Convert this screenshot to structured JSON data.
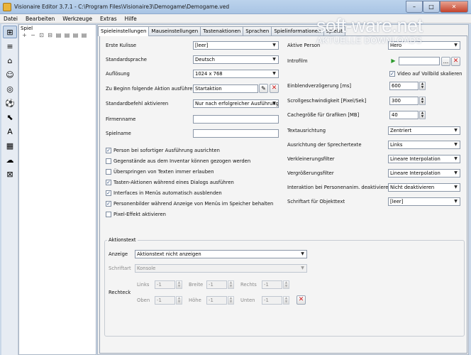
{
  "window": {
    "title": "Visionaire Editor 3.7.1 - C:\\Program Files\\Visionaire3\\Demogame\\Demogame.ved",
    "min_glyph": "–",
    "max_glyph": "□",
    "close_glyph": "✕"
  },
  "watermark": {
    "brand": "soft-ware.net",
    "tagline": "AKTUELLE DOWNLOADS"
  },
  "menu": [
    "Datei",
    "Bearbeiten",
    "Werkzeuge",
    "Extras",
    "Hilfe"
  ],
  "tree": {
    "header": "Spiel",
    "toolbar": [
      "+",
      "−",
      "⊡",
      "⊟",
      "▤",
      "▤",
      "▤",
      "▤"
    ]
  },
  "tabs": [
    "Spieleinstellungen",
    "Mauseinstellungen",
    "Tastenaktionen",
    "Sprachen",
    "Spielinformationen",
    "Spielst"
  ],
  "left": {
    "erste_kulisse": {
      "label": "Erste Kulisse",
      "value": "[leer]"
    },
    "standardsprache": {
      "label": "Standardsprache",
      "value": "Deutsch"
    },
    "aufloesung": {
      "label": "Auflösung",
      "value": "1024 x 768"
    },
    "beginn_aktion": {
      "label": "Zu Beginn folgende Aktion ausführen",
      "value": "Startaktion"
    },
    "standardbefehl": {
      "label": "Standardbefehl aktivieren",
      "value": "Nur nach erfolgreicher Ausführung"
    },
    "firmenname": {
      "label": "Firmenname",
      "value": ""
    },
    "spielname": {
      "label": "Spielname",
      "value": ""
    }
  },
  "checks": [
    {
      "label": "Person bei sofortiger Ausführung ausrichten",
      "checked": true,
      "mark": "✓"
    },
    {
      "label": "Gegenstände aus dem Inventar können gezogen werden",
      "checked": false,
      "mark": ""
    },
    {
      "label": "Überspringen von Texten immer erlauben",
      "checked": false,
      "mark": ""
    },
    {
      "label": "Tasten-Aktionen während eines Dialogs ausführen",
      "checked": true,
      "mark": "✓"
    },
    {
      "label": "Interfaces in Menüs automatisch ausblenden",
      "checked": true,
      "mark": "✓"
    },
    {
      "label": "Personenbilder während Anzeige von Menüs im Speicher behalten",
      "checked": true,
      "mark": "✓"
    },
    {
      "label": "Pixel-Effekt aktivieren",
      "checked": false,
      "mark": ""
    }
  ],
  "right": {
    "aktive_person": {
      "label": "Aktive Person",
      "value": "Hero"
    },
    "introfilm": {
      "label": "Introfilm",
      "value": "",
      "play_glyph": "▶",
      "browse": "...",
      "clear_glyph": "✕"
    },
    "video_skalieren": {
      "label": "Video auf Vollbild skalieren",
      "checked": true,
      "mark": "✓"
    },
    "einblend": {
      "label": "Einblendverzögerung [ms]",
      "value": "600"
    },
    "scroll": {
      "label": "Scrollgeschwindigkeit [Pixel/Sek]",
      "value": "300"
    },
    "cache": {
      "label": "Cachegröße für Grafiken [MB]",
      "value": "40"
    },
    "textausrichtung": {
      "label": "Textausrichtung",
      "value": "Zentriert"
    },
    "sprechertexte": {
      "label": "Ausrichtung der Sprechertexte",
      "value": "Links"
    },
    "verkleinerung": {
      "label": "Verkleinerungsfilter",
      "value": "Lineare Interpolation"
    },
    "vergroesserung": {
      "label": "Vergrößerungsfilter",
      "value": "Lineare Interpolation"
    },
    "interaktion": {
      "label": "Interaktion bei Personenanim. deaktivieren",
      "value": "Nicht deaktivieren"
    },
    "schriftart_obj": {
      "label": "Schriftart für Objekttext",
      "value": "[leer]"
    }
  },
  "aktionstext": {
    "legend": "Aktionstext",
    "anzeige": {
      "label": "Anzeige",
      "value": "Aktionstext nicht anzeigen"
    },
    "schriftart": {
      "label": "Schriftart",
      "value": "Konsole"
    },
    "rechteck": {
      "label": "Rechteck",
      "links": {
        "label": "Links",
        "value": "-1"
      },
      "breite": {
        "label": "Breite",
        "value": "-1"
      },
      "rechts": {
        "label": "Rechts",
        "value": "-1"
      },
      "oben": {
        "label": "Oben",
        "value": "-1"
      },
      "hoehe": {
        "label": "Höhe",
        "value": "-1"
      },
      "unten": {
        "label": "Unten",
        "value": "-1"
      },
      "clear_glyph": "✕"
    }
  },
  "glyphs": {
    "dropdown": "▼",
    "spin_up": "▲",
    "spin_down": "▼",
    "edit": "✎",
    "clear": "✕"
  },
  "left_tools": [
    "⊞",
    "≡",
    "⌂",
    "☺",
    "◎",
    "⚽",
    "⬉",
    "A",
    "▦",
    "☁",
    "⊠"
  ]
}
